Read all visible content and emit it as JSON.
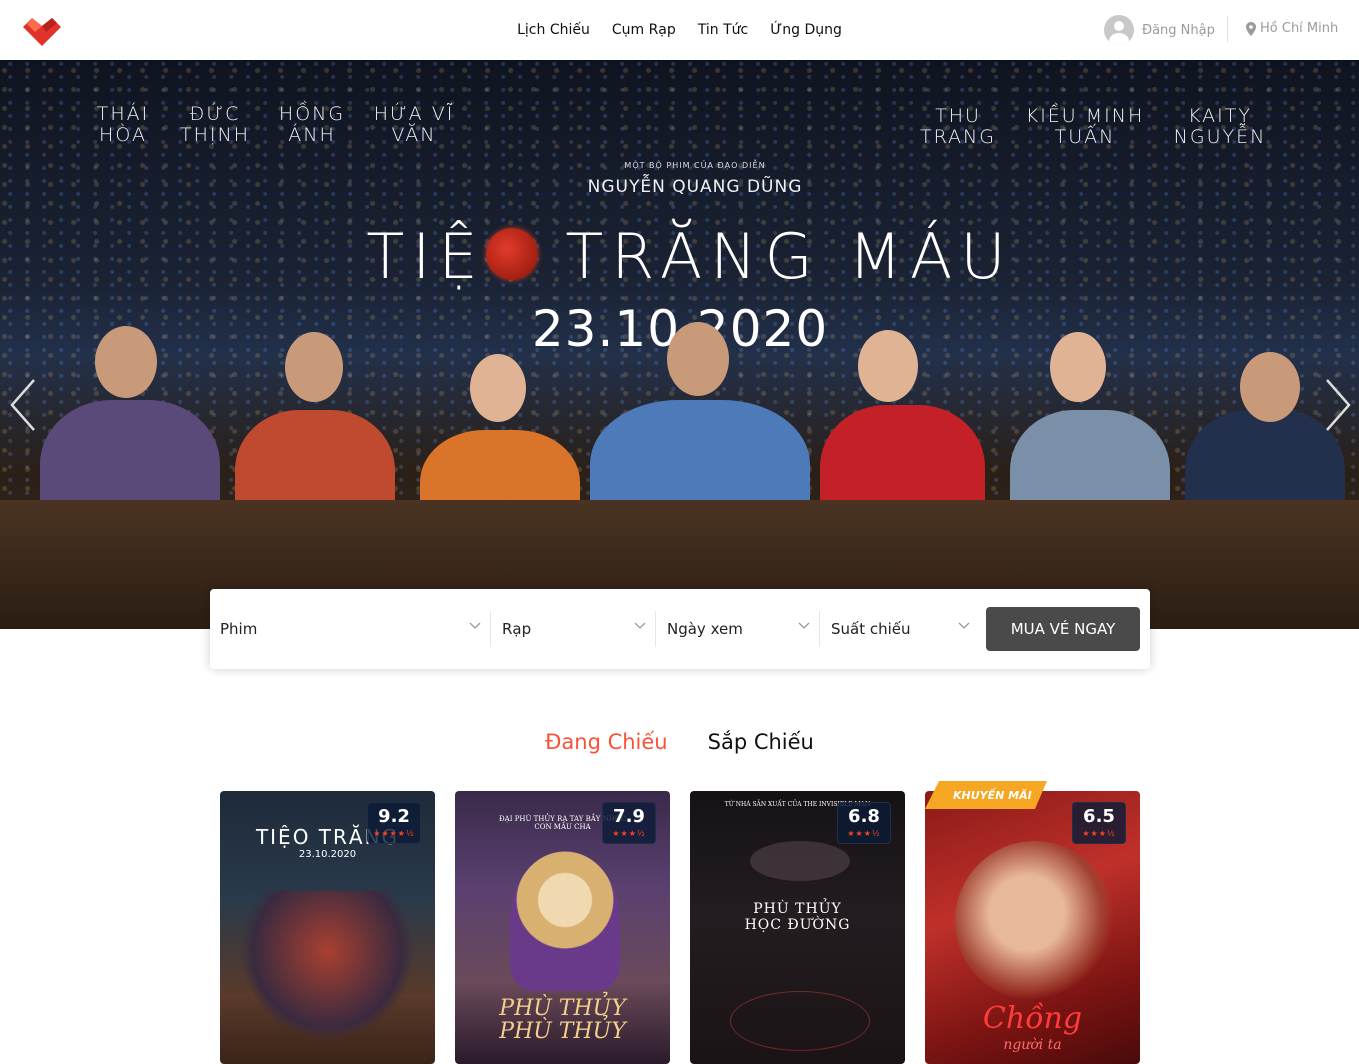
{
  "header": {
    "nav": [
      "Lịch Chiếu",
      "Cụm Rạp",
      "Tin Tức",
      "Ứng Dụng"
    ],
    "login_label": "Đăng Nhập",
    "location": "Hồ Chí Minh",
    "colors": {
      "accent": "#fb4226"
    }
  },
  "banner": {
    "cast_left": [
      "THÁI HÒA",
      "ĐỨC THỊNH",
      "HỒNG ÁNH",
      "HỨA VĨ VĂN"
    ],
    "cast_right": [
      "THU TRANG",
      "KIỀU MINH TUẤN",
      "KAITY NGUYỄN"
    ],
    "director_line": "MỘT BỘ PHIM CỦA ĐẠO DIỄN",
    "director": "NGUYỄN QUANG DŨNG",
    "title_part1": "TIỆ",
    "title_part2": " TRĂNG MÁU",
    "date": "23.10.2020",
    "slide_count": 2,
    "active_slide": 0
  },
  "booking": {
    "movie": "Phim",
    "cinema": "Rạp",
    "date": "Ngày xem",
    "showtime": "Suất chiếu",
    "buy_label": "MUA VÉ NGAY"
  },
  "tabs": [
    {
      "label": "Đang Chiếu",
      "active": true
    },
    {
      "label": "Sắp Chiếu",
      "active": false
    }
  ],
  "movies": [
    {
      "title_line1": "TIỆO TRĂNG",
      "date_line": "23.10.2020",
      "rating": "9.2",
      "stars": "★★★★½"
    },
    {
      "tagline": "ĐẠI PHÙ THỦY RA TAY BẮY NHÓC CON MẦU CHA",
      "title_line1": "PHÙ THỦY",
      "title_line2": "PHÙ THỦY",
      "rating": "7.9",
      "stars": "★★★½"
    },
    {
      "tagline": "TỪ NHÀ SẢN XUẤT CỦA THE INVISIBLE MAN",
      "title_line1": "PHÙ THỦY",
      "title_line2": "HỌC ĐƯỜNG",
      "rating": "6.8",
      "stars": "★★★½"
    },
    {
      "promo": "KHUYẾN MÃI",
      "title_line1": "Chồng",
      "title_line2": "người ta",
      "rating": "6.5",
      "stars": "★★★½"
    }
  ]
}
